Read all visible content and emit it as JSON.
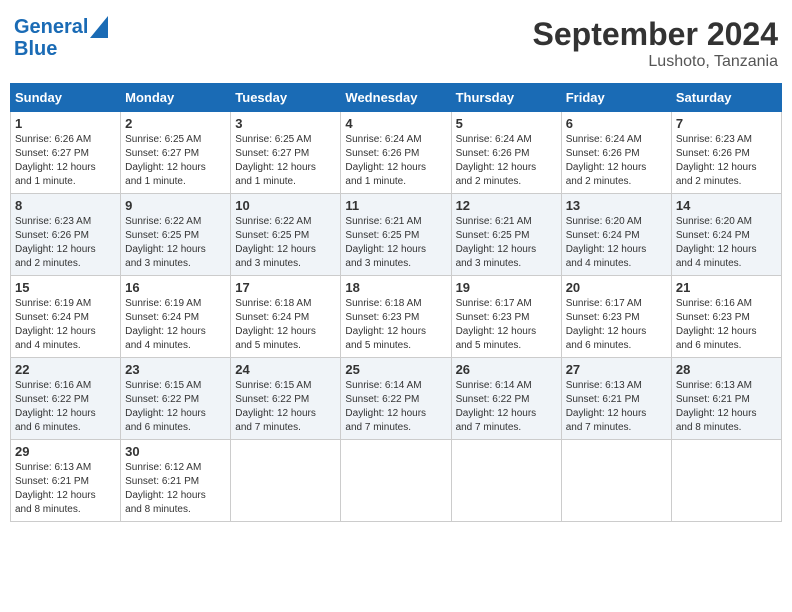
{
  "header": {
    "logo_line1": "General",
    "logo_line2": "Blue",
    "month": "September 2024",
    "location": "Lushoto, Tanzania"
  },
  "columns": [
    "Sunday",
    "Monday",
    "Tuesday",
    "Wednesday",
    "Thursday",
    "Friday",
    "Saturday"
  ],
  "weeks": [
    [
      {
        "day": "1",
        "info": "Sunrise: 6:26 AM\nSunset: 6:27 PM\nDaylight: 12 hours\nand 1 minute."
      },
      {
        "day": "2",
        "info": "Sunrise: 6:25 AM\nSunset: 6:27 PM\nDaylight: 12 hours\nand 1 minute."
      },
      {
        "day": "3",
        "info": "Sunrise: 6:25 AM\nSunset: 6:27 PM\nDaylight: 12 hours\nand 1 minute."
      },
      {
        "day": "4",
        "info": "Sunrise: 6:24 AM\nSunset: 6:26 PM\nDaylight: 12 hours\nand 1 minute."
      },
      {
        "day": "5",
        "info": "Sunrise: 6:24 AM\nSunset: 6:26 PM\nDaylight: 12 hours\nand 2 minutes."
      },
      {
        "day": "6",
        "info": "Sunrise: 6:24 AM\nSunset: 6:26 PM\nDaylight: 12 hours\nand 2 minutes."
      },
      {
        "day": "7",
        "info": "Sunrise: 6:23 AM\nSunset: 6:26 PM\nDaylight: 12 hours\nand 2 minutes."
      }
    ],
    [
      {
        "day": "8",
        "info": "Sunrise: 6:23 AM\nSunset: 6:26 PM\nDaylight: 12 hours\nand 2 minutes."
      },
      {
        "day": "9",
        "info": "Sunrise: 6:22 AM\nSunset: 6:25 PM\nDaylight: 12 hours\nand 3 minutes."
      },
      {
        "day": "10",
        "info": "Sunrise: 6:22 AM\nSunset: 6:25 PM\nDaylight: 12 hours\nand 3 minutes."
      },
      {
        "day": "11",
        "info": "Sunrise: 6:21 AM\nSunset: 6:25 PM\nDaylight: 12 hours\nand 3 minutes."
      },
      {
        "day": "12",
        "info": "Sunrise: 6:21 AM\nSunset: 6:25 PM\nDaylight: 12 hours\nand 3 minutes."
      },
      {
        "day": "13",
        "info": "Sunrise: 6:20 AM\nSunset: 6:24 PM\nDaylight: 12 hours\nand 4 minutes."
      },
      {
        "day": "14",
        "info": "Sunrise: 6:20 AM\nSunset: 6:24 PM\nDaylight: 12 hours\nand 4 minutes."
      }
    ],
    [
      {
        "day": "15",
        "info": "Sunrise: 6:19 AM\nSunset: 6:24 PM\nDaylight: 12 hours\nand 4 minutes."
      },
      {
        "day": "16",
        "info": "Sunrise: 6:19 AM\nSunset: 6:24 PM\nDaylight: 12 hours\nand 4 minutes."
      },
      {
        "day": "17",
        "info": "Sunrise: 6:18 AM\nSunset: 6:24 PM\nDaylight: 12 hours\nand 5 minutes."
      },
      {
        "day": "18",
        "info": "Sunrise: 6:18 AM\nSunset: 6:23 PM\nDaylight: 12 hours\nand 5 minutes."
      },
      {
        "day": "19",
        "info": "Sunrise: 6:17 AM\nSunset: 6:23 PM\nDaylight: 12 hours\nand 5 minutes."
      },
      {
        "day": "20",
        "info": "Sunrise: 6:17 AM\nSunset: 6:23 PM\nDaylight: 12 hours\nand 6 minutes."
      },
      {
        "day": "21",
        "info": "Sunrise: 6:16 AM\nSunset: 6:23 PM\nDaylight: 12 hours\nand 6 minutes."
      }
    ],
    [
      {
        "day": "22",
        "info": "Sunrise: 6:16 AM\nSunset: 6:22 PM\nDaylight: 12 hours\nand 6 minutes."
      },
      {
        "day": "23",
        "info": "Sunrise: 6:15 AM\nSunset: 6:22 PM\nDaylight: 12 hours\nand 6 minutes."
      },
      {
        "day": "24",
        "info": "Sunrise: 6:15 AM\nSunset: 6:22 PM\nDaylight: 12 hours\nand 7 minutes."
      },
      {
        "day": "25",
        "info": "Sunrise: 6:14 AM\nSunset: 6:22 PM\nDaylight: 12 hours\nand 7 minutes."
      },
      {
        "day": "26",
        "info": "Sunrise: 6:14 AM\nSunset: 6:22 PM\nDaylight: 12 hours\nand 7 minutes."
      },
      {
        "day": "27",
        "info": "Sunrise: 6:13 AM\nSunset: 6:21 PM\nDaylight: 12 hours\nand 7 minutes."
      },
      {
        "day": "28",
        "info": "Sunrise: 6:13 AM\nSunset: 6:21 PM\nDaylight: 12 hours\nand 8 minutes."
      }
    ],
    [
      {
        "day": "29",
        "info": "Sunrise: 6:13 AM\nSunset: 6:21 PM\nDaylight: 12 hours\nand 8 minutes."
      },
      {
        "day": "30",
        "info": "Sunrise: 6:12 AM\nSunset: 6:21 PM\nDaylight: 12 hours\nand 8 minutes."
      },
      {
        "day": "",
        "info": ""
      },
      {
        "day": "",
        "info": ""
      },
      {
        "day": "",
        "info": ""
      },
      {
        "day": "",
        "info": ""
      },
      {
        "day": "",
        "info": ""
      }
    ]
  ]
}
